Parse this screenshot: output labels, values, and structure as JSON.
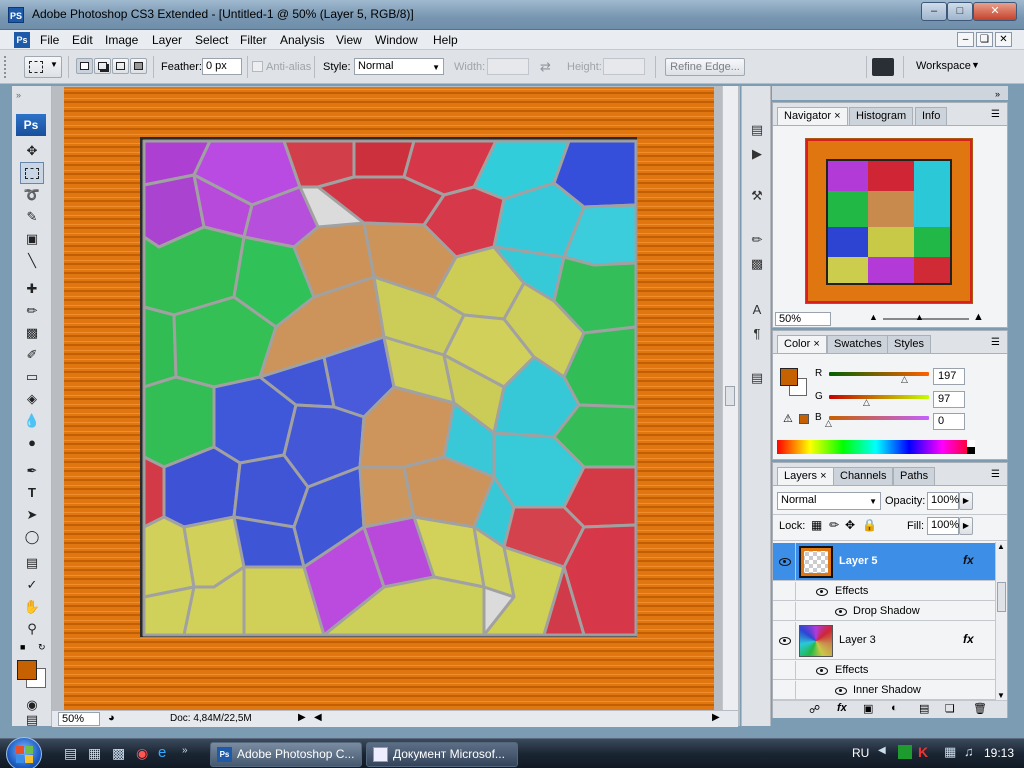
{
  "window": {
    "app_icon": "PS",
    "title": "Adobe Photoshop CS3 Extended - [Untitled-1 @ 50% (Layer 5, RGB/8)]",
    "controls": [
      "minimize",
      "maximize",
      "close"
    ]
  },
  "menubar": {
    "items": [
      "File",
      "Edit",
      "Image",
      "Layer",
      "Select",
      "Filter",
      "Analysis",
      "View",
      "Window",
      "Help"
    ]
  },
  "options": {
    "feather_label": "Feather:",
    "feather_value": "0 px",
    "antialias_label": "Anti-alias",
    "style_label": "Style:",
    "style_value": "Normal",
    "width_label": "Width:",
    "height_label": "Height:",
    "refine_edge": "Refine Edge...",
    "workspace": "Workspace"
  },
  "toolbox": {
    "logo": "Ps"
  },
  "status": {
    "zoom": "50%",
    "doc": "Doc: 4,84M/22,5M"
  },
  "navigator": {
    "tabs": [
      "Navigator",
      "Histogram",
      "Info"
    ],
    "zoom": "50%"
  },
  "color_panel": {
    "tabs": [
      "Color",
      "Swatches",
      "Styles"
    ],
    "r_label": "R",
    "r_value": "197",
    "g_label": "G",
    "g_value": "97",
    "b_label": "B",
    "b_value": "0",
    "foreground": "#c56100"
  },
  "layers_panel": {
    "tabs": [
      "Layers",
      "Channels",
      "Paths"
    ],
    "blend_mode": "Normal",
    "opacity_label": "Opacity:",
    "opacity_value": "100%",
    "lock_label": "Lock:",
    "fill_label": "Fill:",
    "fill_value": "100%",
    "layers": [
      {
        "name": "Layer 5",
        "fx": "fx",
        "selected": true,
        "effects_label": "Effects",
        "effect": "Drop Shadow"
      },
      {
        "name": "Layer 3",
        "fx": "fx",
        "selected": false,
        "effects_label": "Effects",
        "effect": "Inner Shadow"
      }
    ]
  },
  "taskbar": {
    "tasks": [
      "Adobe Photoshop C...",
      "Документ Microsof..."
    ],
    "lang": "RU",
    "clock": "19:13"
  },
  "colors": {
    "accent_selected": "#3d8ee6",
    "frame_orange": "#e0760f"
  }
}
